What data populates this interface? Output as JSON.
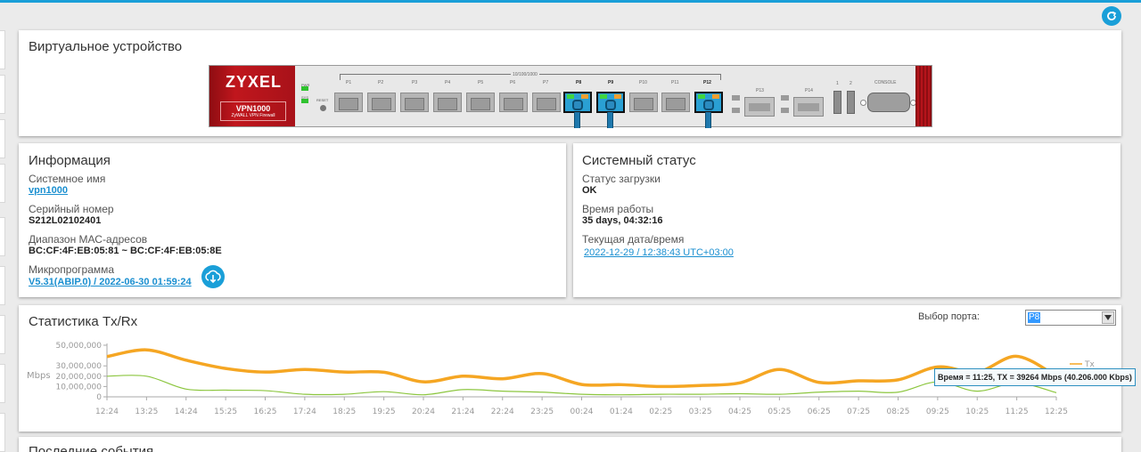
{
  "virtual_device": {
    "title": "Виртуальное устройство",
    "brand": "ZYXEL",
    "model": "VPN1000",
    "model_sub": "ZyWALL VPN Firewall",
    "group_label": "10/100/1000",
    "reset_label": "RESET",
    "led_labels": [
      "PWR",
      "SYS"
    ],
    "ports": [
      "P1",
      "P2",
      "P3",
      "P4",
      "P5",
      "P6",
      "P7",
      "P8",
      "P9",
      "P10",
      "P11",
      "P12"
    ],
    "connected_ports": [
      "P8",
      "P9",
      "P12"
    ],
    "sfp_ports": [
      "P13",
      "P14"
    ],
    "usb_labels": [
      "1",
      "2"
    ],
    "console_label": "CONSOLE"
  },
  "info": {
    "title": "Информация",
    "system_name_label": "Системное имя",
    "system_name": "vpn1000",
    "serial_label": "Серийный номер",
    "serial": "S212L02102401",
    "mac_label": "Диапазон МАС-адресов",
    "mac": "BC:CF:4F:EB:05:81 ~ BC:CF:4F:EB:05:8E",
    "firmware_label": "Микропрограмма",
    "firmware": "V5.31(ABIP.0) / 2022-06-30 01:59:24"
  },
  "status": {
    "title": "Системный статус",
    "boot_label": "Статус загрузки",
    "boot": "OK",
    "uptime_label": "Время работы",
    "uptime": "35 days, 04:32:16",
    "datetime_label": "Текущая дата/время",
    "datetime": "2022-12-29 / 12:38:43 UTC+03:00"
  },
  "stats": {
    "title": "Статистика Tx/Rx",
    "port_select_label": "Выбор порта:",
    "port_selected": "P8",
    "tooltip": "Время = 11:25, TX = 39264 Mbps (40.206.000 Kbps)"
  },
  "events": {
    "title": "Последние события"
  },
  "colors": {
    "accent": "#1a9fd8",
    "tx": "#f5a623",
    "rx": "#8cc63f",
    "device_red": "#c0161d"
  },
  "chart_data": {
    "type": "line",
    "ylabel": "Mbps",
    "yticks": [
      "50,000,000",
      "30,000,000",
      "20,000,000",
      "10,000,000",
      "0"
    ],
    "ytick_values": [
      50000000,
      30000000,
      20000000,
      10000000,
      0
    ],
    "ylim": [
      0,
      50000000
    ],
    "x": [
      "12:24",
      "13:25",
      "14:24",
      "15:25",
      "16:25",
      "17:24",
      "18:25",
      "19:25",
      "20:24",
      "21:24",
      "22:24",
      "23:25",
      "00:24",
      "01:24",
      "02:25",
      "03:25",
      "04:25",
      "05:25",
      "06:25",
      "07:25",
      "08:25",
      "09:25",
      "10:25",
      "11:25",
      "12:25"
    ],
    "legend": [
      "Tx"
    ],
    "series": [
      {
        "name": "Tx",
        "values": [
          39000000,
          45500000,
          35500000,
          27500000,
          24000000,
          26500000,
          24000000,
          23800000,
          14500000,
          20000000,
          17500000,
          22500000,
          12000000,
          11800000,
          10000000,
          11000000,
          13500000,
          26500000,
          14000000,
          15500000,
          16500000,
          29000000,
          24000000,
          39264000,
          20000000
        ]
      },
      {
        "name": "",
        "values": [
          20000000,
          20000000,
          7500000,
          6500000,
          6000000,
          2500000,
          2500000,
          5000000,
          2000000,
          7000000,
          5500000,
          4500000,
          2500000,
          2000000,
          2500000,
          2500000,
          3000000,
          2500000,
          4500000,
          5500000,
          4500000,
          14500000,
          5500000,
          13500000,
          4000000
        ]
      }
    ],
    "grid": false,
    "legend_position": "right"
  }
}
